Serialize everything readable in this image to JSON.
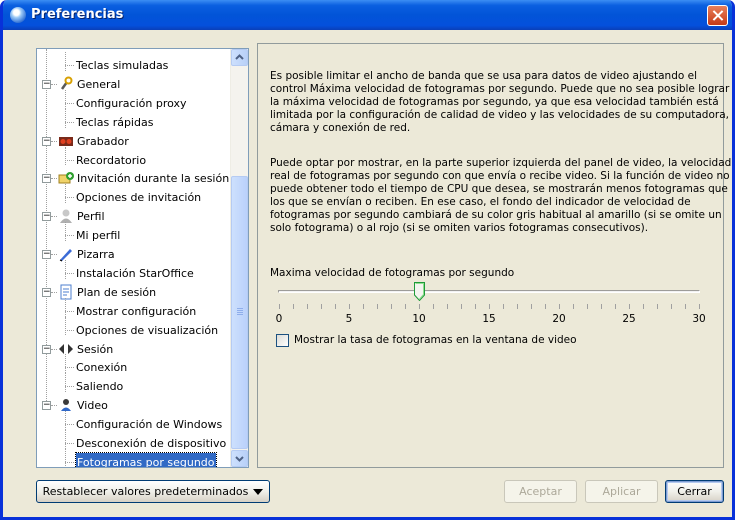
{
  "window": {
    "title": "Preferencias"
  },
  "tree": {
    "items": [
      {
        "label": "Teclas simuladas",
        "level": 1,
        "icon": ""
      },
      {
        "label": "General",
        "level": 0,
        "icon": "wrench-icon",
        "expanded": true
      },
      {
        "label": "Configuración proxy",
        "level": 1,
        "icon": ""
      },
      {
        "label": "Teclas rápidas",
        "level": 1,
        "icon": ""
      },
      {
        "label": "Grabador",
        "level": 0,
        "icon": "recorder-icon",
        "expanded": true
      },
      {
        "label": "Recordatorio",
        "level": 1,
        "icon": ""
      },
      {
        "label": "Invitación durante la sesión",
        "level": 0,
        "icon": "invite-icon",
        "expanded": true
      },
      {
        "label": "Opciones de invitación",
        "level": 1,
        "icon": ""
      },
      {
        "label": "Perfil",
        "level": 0,
        "icon": "profile-icon",
        "expanded": true
      },
      {
        "label": "Mi perfil",
        "level": 1,
        "icon": ""
      },
      {
        "label": "Pizarra",
        "level": 0,
        "icon": "pen-icon",
        "expanded": true
      },
      {
        "label": "Instalación StarOffice",
        "level": 1,
        "icon": ""
      },
      {
        "label": "Plan de sesión",
        "level": 0,
        "icon": "plan-icon",
        "expanded": true
      },
      {
        "label": "Mostrar configuración",
        "level": 1,
        "icon": ""
      },
      {
        "label": "Opciones de visualización",
        "level": 1,
        "icon": ""
      },
      {
        "label": "Sesión",
        "level": 0,
        "icon": "session-arrows-icon",
        "expanded": true
      },
      {
        "label": "Conexión",
        "level": 1,
        "icon": ""
      },
      {
        "label": "Saliendo",
        "level": 1,
        "icon": ""
      },
      {
        "label": "Video",
        "level": 0,
        "icon": "video-person-icon",
        "expanded": true
      },
      {
        "label": "Configuración de Windows",
        "level": 1,
        "icon": ""
      },
      {
        "label": "Desconexión de dispositivo",
        "level": 1,
        "icon": ""
      },
      {
        "label": "Fotogramas por segundo",
        "level": 1,
        "icon": "",
        "selected": true
      }
    ]
  },
  "panel": {
    "paragraph1": [
      "Es posible limitar el ancho de banda que se usa para datos de video ajustando el",
      "control Máxima velocidad de fotogramas por segundo.  Puede que no sea posible lograr",
      "la máxima velocidad de fotogramas por segundo, ya que esa velocidad también está",
      "limitada por la configuración de calidad de video y las velocidades de su computadora,",
      "cámara y conexión de red."
    ],
    "paragraph2": [
      "Puede optar por mostrar, en la parte superior izquierda del panel de video, la velocidad",
      "real de fotogramas por segundo con que envía o recibe video.  Si la función de video no",
      "puede obtener todo el tiempo de CPU que desea, se mostrarán menos fotogramas que",
      "los que se envían o reciben.  En ese caso, el fondo del indicador de velocidad de",
      "fotogramas por segundo cambiará de su color gris habitual al amarillo (si se omite un",
      "solo fotograma) o al rojo (si se omiten varios fotogramas consecutivos)."
    ],
    "slider": {
      "label": "Maxima velocidad de fotogramas por segundo",
      "min": 0,
      "max": 30,
      "value": 10,
      "tick_labels": [
        "0",
        "5",
        "10",
        "15",
        "20",
        "25",
        "30"
      ]
    },
    "checkbox": {
      "label": "Mostrar la tasa de fotogramas en la ventana de video",
      "checked": false
    }
  },
  "buttons": {
    "reset": "Restablecer valores predeterminados",
    "accept": "Aceptar",
    "apply": "Aplicar",
    "close": "Cerrar"
  }
}
